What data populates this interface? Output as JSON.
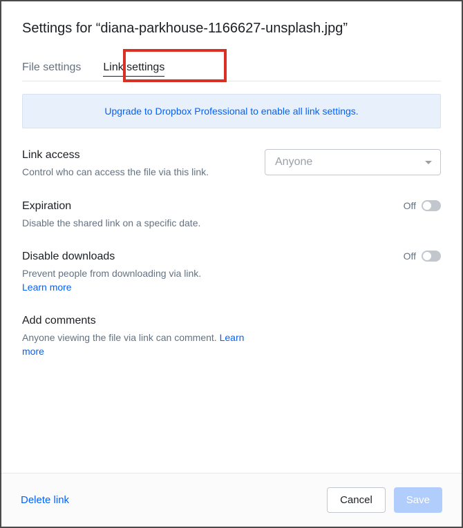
{
  "title": "Settings for “diana-parkhouse-1166627-unsplash.jpg”",
  "tabs": {
    "file": "File settings",
    "link": "Link settings"
  },
  "banner": "Upgrade to Dropbox Professional to enable all link settings.",
  "sections": {
    "link_access": {
      "title": "Link access",
      "desc": "Control who can access the file via this link.",
      "selected": "Anyone"
    },
    "expiration": {
      "title": "Expiration",
      "desc": "Disable the shared link on a specific date.",
      "toggle_label": "Off"
    },
    "disable_downloads": {
      "title": "Disable downloads",
      "desc": "Prevent people from downloading via link.",
      "learn_more": "Learn more",
      "toggle_label": "Off"
    },
    "add_comments": {
      "title": "Add comments",
      "desc": "Anyone viewing the file via link can comment. ",
      "learn_more": "Learn more"
    }
  },
  "footer": {
    "delete": "Delete link",
    "cancel": "Cancel",
    "save": "Save"
  }
}
